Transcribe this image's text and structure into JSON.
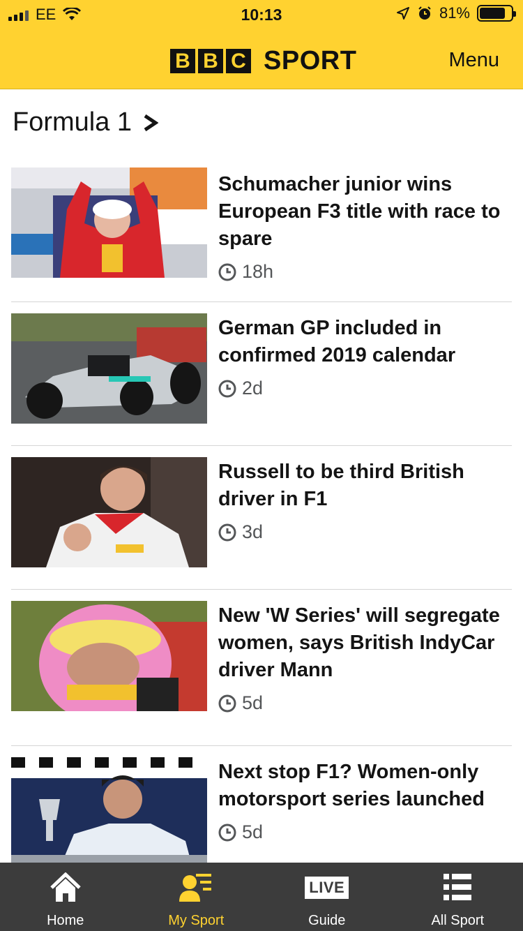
{
  "status_bar": {
    "carrier": "EE",
    "time": "10:13",
    "battery_percent": "81%",
    "battery_level": 0.81
  },
  "header": {
    "brand_letters": [
      "B",
      "B",
      "C"
    ],
    "brand_word": "SPORT",
    "menu_label": "Menu",
    "accent_color": "#ffd230"
  },
  "section": {
    "title": "Formula 1"
  },
  "articles": [
    {
      "headline": "Schumacher junior wins European F3 title with race to spare",
      "age": "18h",
      "image_icon": "driver-podium-photo"
    },
    {
      "headline": "German GP included in confirmed 2019 calendar",
      "age": "2d",
      "image_icon": "f1-car-photo"
    },
    {
      "headline": "Russell to be third British driver in F1",
      "age": "3d",
      "image_icon": "driver-celebrating-photo"
    },
    {
      "headline": "New 'W Series' will segregate women, says British IndyCar driver Mann",
      "age": "5d",
      "image_icon": "driver-helmet-photo"
    },
    {
      "headline": "Next stop F1? Women-only motorsport series launched",
      "age": "5d",
      "image_icon": "driver-trophy-photo"
    }
  ],
  "bottom_nav": [
    {
      "label": "Home",
      "icon": "house-icon",
      "active": false
    },
    {
      "label": "My Sport",
      "icon": "my-sport-icon",
      "active": true
    },
    {
      "label": "Guide",
      "icon": "live-icon",
      "badge": "LIVE",
      "active": false
    },
    {
      "label": "All Sport",
      "icon": "list-icon",
      "active": false
    }
  ]
}
